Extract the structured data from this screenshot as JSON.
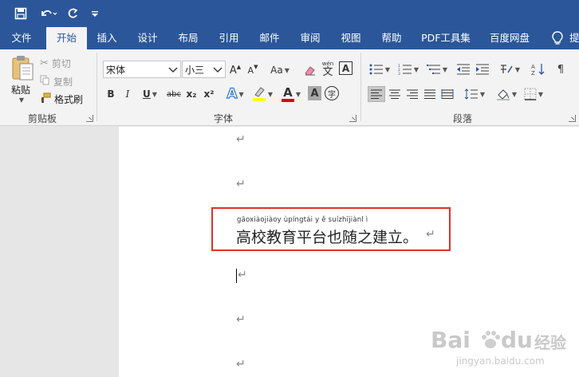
{
  "quick_access": {
    "save_icon": "save-icon",
    "undo_icon": "undo-icon",
    "redo_icon": "redo-icon",
    "customize_icon": "customize-icon"
  },
  "tabs": [
    {
      "label": "文件"
    },
    {
      "label": "开始",
      "active": true
    },
    {
      "label": "插入"
    },
    {
      "label": "设计"
    },
    {
      "label": "布局"
    },
    {
      "label": "引用"
    },
    {
      "label": "邮件"
    },
    {
      "label": "审阅"
    },
    {
      "label": "视图"
    },
    {
      "label": "帮助"
    },
    {
      "label": "PDF工具集"
    },
    {
      "label": "百度网盘"
    },
    {
      "label": "提"
    }
  ],
  "clipboard": {
    "group_label": "剪贴板",
    "paste_label": "粘贴",
    "cut_label": "剪切",
    "copy_label": "复制",
    "format_painter_label": "格式刷"
  },
  "font": {
    "group_label": "字体",
    "font_name": "宋体",
    "font_size": "小三",
    "change_case_label": "Aa",
    "bold": "B",
    "italic": "I",
    "underline": "U",
    "strikethrough": "abc",
    "subscript": "x₂",
    "superscript": "x²",
    "grow_font": "A",
    "shrink_font": "A",
    "phonetic_label": "wén",
    "phonetic_char": "文",
    "border_char": "A",
    "font_color_label": "A",
    "shading_label": "A",
    "enclose_char": "字",
    "text_effect_label": "A",
    "highlight_color": "#ffff00",
    "font_color": "#e00000"
  },
  "paragraph": {
    "group_label": "段落"
  },
  "document": {
    "para_mark": "↵",
    "pinyin": "gāoxiàojiàoyùpíngtáiyěsuízhījiànlì",
    "pinyin_display": "gāoxiàojiàoy ùpíngtái y ě suízhījiànl ì",
    "text": "高校教育平台也随之建立。"
  },
  "watermark": {
    "brand": "Bai",
    "brand2": "du",
    "suffix": "经验",
    "url": "jingyan.baidu.com"
  },
  "colors": {
    "titlebar": "#2b579a",
    "ribbon": "#f3f3f3",
    "highlight_box": "#e0302e"
  }
}
